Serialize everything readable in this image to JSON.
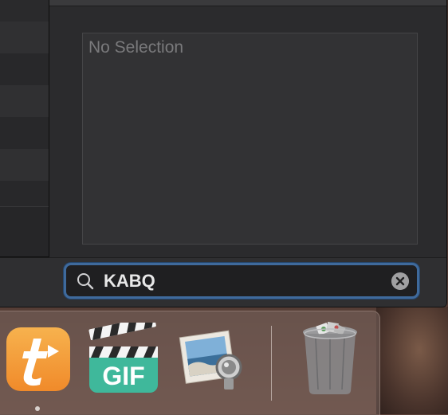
{
  "detail": {
    "preview_placeholder": "No Selection"
  },
  "search": {
    "value": "KABQ",
    "placeholder": ""
  },
  "icons": {
    "search": "magnifying-glass-icon",
    "clear": "clear-circle-x-icon"
  },
  "dock": {
    "apps": [
      {
        "name": "t-app-icon",
        "running": true
      },
      {
        "name": "gif-brewery-icon",
        "running": false
      },
      {
        "name": "preview-app-icon",
        "running": false
      },
      {
        "name": "trash-icon",
        "running": false
      }
    ]
  },
  "colors": {
    "focus_ring": "#3f6a9c",
    "window_bg": "#2b2b2d",
    "placeholder_text": "#7a7a7c"
  }
}
